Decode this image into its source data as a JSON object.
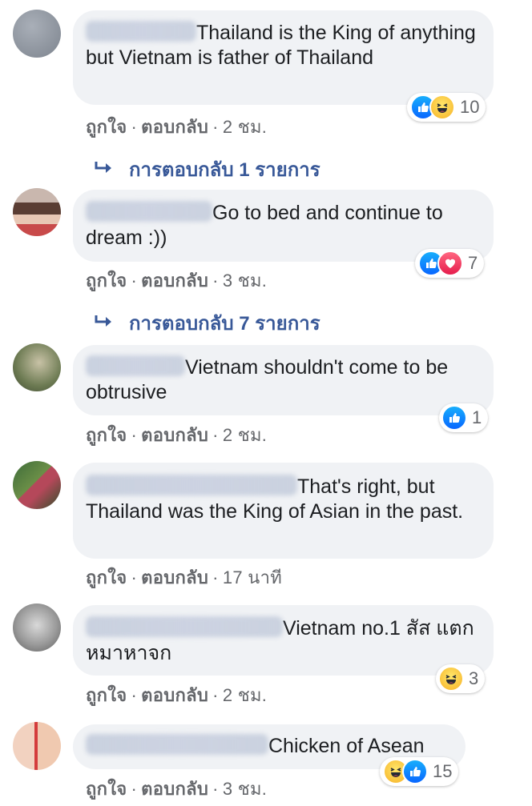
{
  "comments": [
    {
      "text": "Thailand is the King of anything but Vietnam is father of Thailand",
      "like": "ถูกใจ",
      "reply": "ตอบกลับ",
      "time": "2 ชม.",
      "reactions": [
        "like",
        "haha"
      ],
      "reaction_count": "10",
      "replies": "การตอบกลับ 1 รายการ"
    },
    {
      "text": "Go to bed and continue to dream :))",
      "like": "ถูกใจ",
      "reply": "ตอบกลับ",
      "time": "3 ชม.",
      "reactions": [
        "like",
        "love"
      ],
      "reaction_count": "7",
      "replies": "การตอบกลับ 7 รายการ"
    },
    {
      "text": "Vietnam shouldn't come to be obtrusive",
      "like": "ถูกใจ",
      "reply": "ตอบกลับ",
      "time": "2 ชม.",
      "reactions": [
        "like"
      ],
      "reaction_count": "1"
    },
    {
      "text": "That's right, but Thailand was the King of Asian in the past.",
      "like": "ถูกใจ",
      "reply": "ตอบกลับ",
      "time": "17 นาที"
    },
    {
      "text": "Vietnam no.1 สัส แตกหมาหาจก",
      "like": "ถูกใจ",
      "reply": "ตอบกลับ",
      "time": "2 ชม.",
      "reactions": [
        "haha"
      ],
      "reaction_count": "3"
    },
    {
      "text": "Chicken of Asean",
      "like": "ถูกใจ",
      "reply": "ตอบกลับ",
      "time": "3 ชม.",
      "reactions": [
        "haha",
        "like"
      ],
      "reaction_count": "15"
    }
  ],
  "colors": {
    "bubble": "#f0f2f5",
    "link": "#385898",
    "meta": "#65676b",
    "like_blue": "#0866ff",
    "love_red": "#e61e4d",
    "haha_yellow": "#f7b125"
  }
}
